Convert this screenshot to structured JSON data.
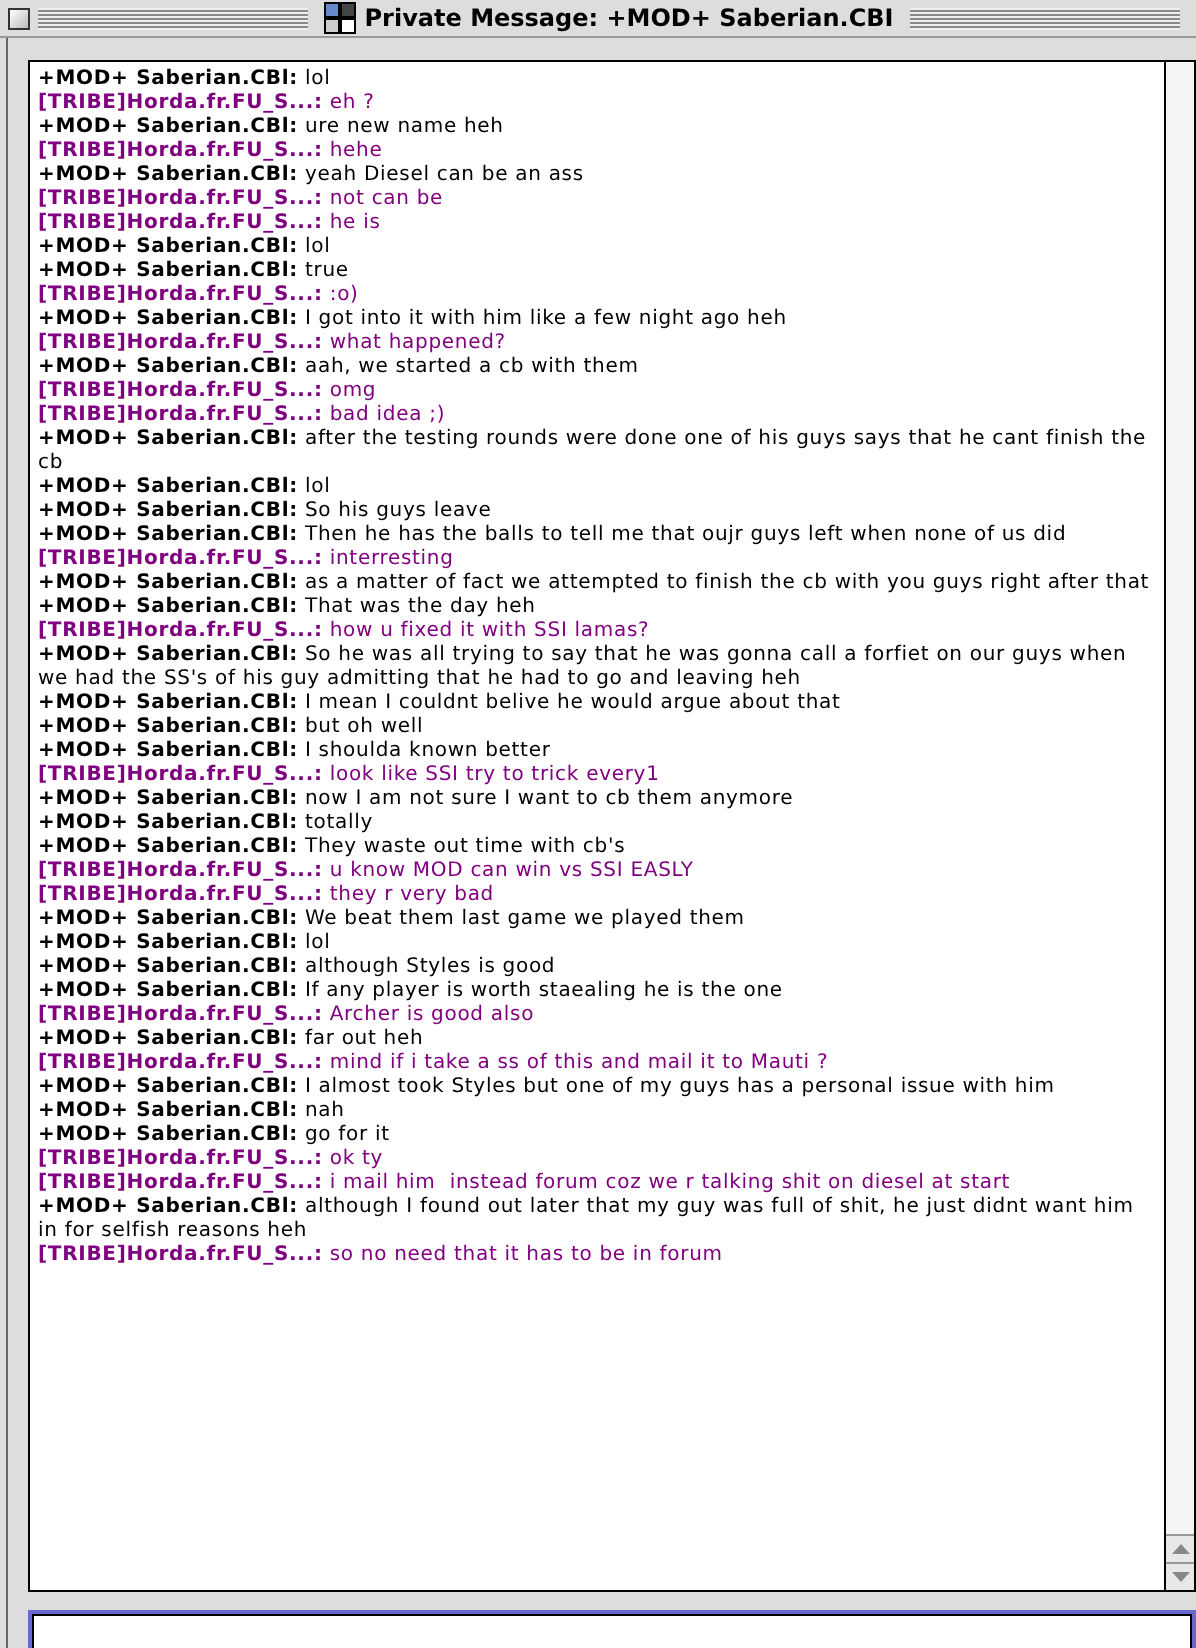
{
  "window": {
    "title": "Private Message: +MOD+ Saberian.CBI"
  },
  "messages": [
    {
      "kind": "mod",
      "sender": "+MOD+ Saberian.CBl:",
      "text": "lol"
    },
    {
      "kind": "tribe",
      "sender": "[TRIBE]Horda.fr.FU_S...:",
      "text": "eh ?"
    },
    {
      "kind": "mod",
      "sender": "+MOD+ Saberian.CBl:",
      "text": "ure new name heh"
    },
    {
      "kind": "tribe",
      "sender": "[TRIBE]Horda.fr.FU_S...:",
      "text": "hehe"
    },
    {
      "kind": "mod",
      "sender": "+MOD+ Saberian.CBl:",
      "text": "yeah Diesel can be an ass"
    },
    {
      "kind": "tribe",
      "sender": "[TRIBE]Horda.fr.FU_S...:",
      "text": "not can be"
    },
    {
      "kind": "tribe",
      "sender": "[TRIBE]Horda.fr.FU_S...:",
      "text": "he is"
    },
    {
      "kind": "mod",
      "sender": "+MOD+ Saberian.CBl:",
      "text": "lol"
    },
    {
      "kind": "mod",
      "sender": "+MOD+ Saberian.CBl:",
      "text": "true"
    },
    {
      "kind": "tribe",
      "sender": "[TRIBE]Horda.fr.FU_S...:",
      "text": ":o)"
    },
    {
      "kind": "mod",
      "sender": "+MOD+ Saberian.CBl:",
      "text": "I got into it with him like a few night ago heh"
    },
    {
      "kind": "tribe",
      "sender": "[TRIBE]Horda.fr.FU_S...:",
      "text": "what happened?"
    },
    {
      "kind": "mod",
      "sender": "+MOD+ Saberian.CBl:",
      "text": "aah, we started a cb with them"
    },
    {
      "kind": "tribe",
      "sender": "[TRIBE]Horda.fr.FU_S...:",
      "text": "omg"
    },
    {
      "kind": "tribe",
      "sender": "[TRIBE]Horda.fr.FU_S...:",
      "text": "bad idea ;)"
    },
    {
      "kind": "mod",
      "sender": "+MOD+ Saberian.CBl:",
      "text": "after the testing rounds were done one of his guys says that he cant finish the cb"
    },
    {
      "kind": "mod",
      "sender": "+MOD+ Saberian.CBl:",
      "text": "lol"
    },
    {
      "kind": "mod",
      "sender": "+MOD+ Saberian.CBl:",
      "text": "So his guys leave"
    },
    {
      "kind": "mod",
      "sender": "+MOD+ Saberian.CBl:",
      "text": "Then he has the balls to tell me that oujr guys left when none of us did"
    },
    {
      "kind": "tribe",
      "sender": "[TRIBE]Horda.fr.FU_S...:",
      "text": "interresting"
    },
    {
      "kind": "mod",
      "sender": "+MOD+ Saberian.CBl:",
      "text": "as a matter of fact we attempted to finish the cb with you guys right after that"
    },
    {
      "kind": "mod",
      "sender": "+MOD+ Saberian.CBl:",
      "text": "That was the day heh"
    },
    {
      "kind": "tribe",
      "sender": "[TRIBE]Horda.fr.FU_S...:",
      "text": "how u fixed it with SSI lamas?"
    },
    {
      "kind": "mod",
      "sender": "+MOD+ Saberian.CBl:",
      "text": "So he was all trying to say that he was gonna call a forfiet on our guys when we had the SS's of his guy admitting that he had to go and leaving heh"
    },
    {
      "kind": "mod",
      "sender": "+MOD+ Saberian.CBl:",
      "text": "I mean I couldnt belive he would argue about that"
    },
    {
      "kind": "mod",
      "sender": "+MOD+ Saberian.CBl:",
      "text": "but oh well"
    },
    {
      "kind": "mod",
      "sender": "+MOD+ Saberian.CBl:",
      "text": "I shoulda known better"
    },
    {
      "kind": "tribe",
      "sender": "[TRIBE]Horda.fr.FU_S...:",
      "text": "look like SSI try to trick every1"
    },
    {
      "kind": "mod",
      "sender": "+MOD+ Saberian.CBl:",
      "text": "now I am not sure I want to cb them anymore"
    },
    {
      "kind": "mod",
      "sender": "+MOD+ Saberian.CBl:",
      "text": "totally"
    },
    {
      "kind": "mod",
      "sender": "+MOD+ Saberian.CBl:",
      "text": "They waste out time with cb's"
    },
    {
      "kind": "tribe",
      "sender": "[TRIBE]Horda.fr.FU_S...:",
      "text": "u know MOD can win vs SSI EASLY"
    },
    {
      "kind": "tribe",
      "sender": "[TRIBE]Horda.fr.FU_S...:",
      "text": "they r very bad"
    },
    {
      "kind": "mod",
      "sender": "+MOD+ Saberian.CBl:",
      "text": "We beat them last game we played them"
    },
    {
      "kind": "mod",
      "sender": "+MOD+ Saberian.CBl:",
      "text": "lol"
    },
    {
      "kind": "mod",
      "sender": "+MOD+ Saberian.CBl:",
      "text": "although Styles is good"
    },
    {
      "kind": "mod",
      "sender": "+MOD+ Saberian.CBl:",
      "text": "If any player is worth staealing he is the one"
    },
    {
      "kind": "tribe",
      "sender": "[TRIBE]Horda.fr.FU_S...:",
      "text": "Archer is good also"
    },
    {
      "kind": "mod",
      "sender": "+MOD+ Saberian.CBl:",
      "text": "far out heh"
    },
    {
      "kind": "tribe",
      "sender": "[TRIBE]Horda.fr.FU_S...:",
      "text": "mind if i take a ss of this and mail it to Mauti ?"
    },
    {
      "kind": "mod",
      "sender": "+MOD+ Saberian.CBl:",
      "text": "I almost took Styles but one of my guys has a personal issue with him"
    },
    {
      "kind": "mod",
      "sender": "+MOD+ Saberian.CBl:",
      "text": "nah"
    },
    {
      "kind": "mod",
      "sender": "+MOD+ Saberian.CBl:",
      "text": "go for it"
    },
    {
      "kind": "tribe",
      "sender": "[TRIBE]Horda.fr.FU_S...:",
      "text": "ok ty"
    },
    {
      "kind": "tribe",
      "sender": "[TRIBE]Horda.fr.FU_S...:",
      "text": "i mail him  instead forum coz we r talking shit on diesel at start"
    },
    {
      "kind": "mod",
      "sender": "+MOD+ Saberian.CBl:",
      "text": "although I found out later that my guy was full of shit, he just didnt want him in for selfish reasons heh"
    },
    {
      "kind": "tribe",
      "sender": "[TRIBE]Horda.fr.FU_S...:",
      "text": "so no need that it has to be in forum"
    }
  ]
}
